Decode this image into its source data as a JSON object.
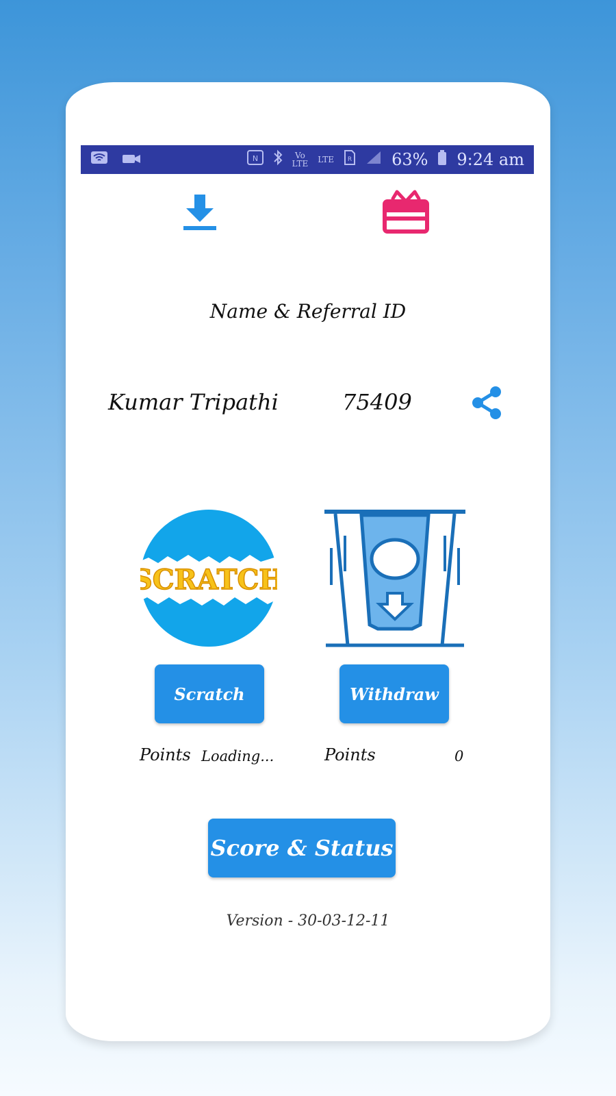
{
  "status_bar": {
    "network_type": "LTE",
    "battery": "63%",
    "time": "9:24 am",
    "icons": [
      "wifi-icon",
      "video-icon",
      "nfc-icon",
      "bluetooth-icon",
      "volte-icon",
      "lte-icon",
      "signal-icon",
      "battery-icon"
    ]
  },
  "toolbar": {
    "download_icon": "download-icon",
    "gift_icon": "gift-icon"
  },
  "profile": {
    "heading": "Name & Referral ID",
    "name": "Kumar Tripathi",
    "referral_id": "75409",
    "share_icon": "share-icon"
  },
  "scratch": {
    "logo_text": "SCRATCH",
    "button_label": "Scratch",
    "points_label": "Points",
    "points_value": "Loading..."
  },
  "withdraw": {
    "button_label": "Withdraw",
    "points_label": "Points",
    "points_value": "0"
  },
  "score_button_label": "Score & Status",
  "version": "Version - 30-03-12-11",
  "colors": {
    "accent": "#2490e6",
    "status_bar": "#2e3aa1",
    "gift": "#e8286f",
    "scratch_yellow": "#f7c21a"
  }
}
